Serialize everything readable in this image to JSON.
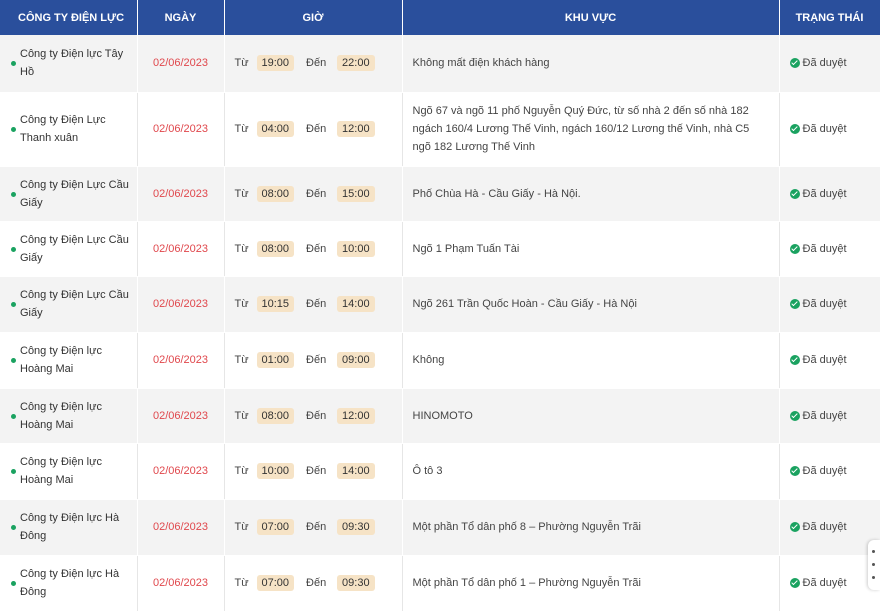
{
  "headers": {
    "company": "CÔNG TY ĐIỆN LỰC",
    "date": "NGÀY",
    "time": "GIỜ",
    "area": "KHU VỰC",
    "status": "TRẠNG THÁI"
  },
  "labels": {
    "from": "Từ",
    "to": "Đến"
  },
  "colors": {
    "header_bg": "#2a4f9c",
    "date": "#e0474c",
    "time_pill": "#f6e3c6",
    "status_green": "#1aa260"
  },
  "rows": [
    {
      "company": "Công ty Điện lực Tây Hồ",
      "date": "02/06/2023",
      "from": "19:00",
      "to": "22:00",
      "area": "Không mất điện khách hàng",
      "status": "Đã duyệt"
    },
    {
      "company": "Công ty Điện Lực Thanh xuân",
      "date": "02/06/2023",
      "from": "04:00",
      "to": "12:00",
      "area": "Ngõ 67 và ngõ 11 phố Nguyễn Quý Đức, từ số nhà 2 đến số nhà 182 ngách 160/4 Lương Thế Vinh, ngách 160/12 Lương thế Vinh, nhà C5 ngõ 182 Lương Thế Vinh",
      "status": "Đã duyệt"
    },
    {
      "company": "Công ty Điện Lực Cầu Giấy",
      "date": "02/06/2023",
      "from": "08:00",
      "to": "15:00",
      "area": "Phố Chùa Hà - Cầu Giấy - Hà Nội.",
      "status": "Đã duyệt"
    },
    {
      "company": "Công ty Điện Lực Cầu Giấy",
      "date": "02/06/2023",
      "from": "08:00",
      "to": "10:00",
      "area": "Ngõ 1 Phạm Tuấn Tài",
      "status": "Đã duyệt"
    },
    {
      "company": "Công ty Điện Lực Cầu Giấy",
      "date": "02/06/2023",
      "from": "10:15",
      "to": "14:00",
      "area": "Ngõ 261 Trần Quốc Hoàn - Cầu Giấy - Hà Nội",
      "status": "Đã duyệt"
    },
    {
      "company": "Công ty Điện lực Hoàng Mai",
      "date": "02/06/2023",
      "from": "01:00",
      "to": "09:00",
      "area": "Không",
      "status": "Đã duyệt"
    },
    {
      "company": "Công ty Điện lực Hoàng Mai",
      "date": "02/06/2023",
      "from": "08:00",
      "to": "12:00",
      "area": "HINOMOTO",
      "status": "Đã duyệt"
    },
    {
      "company": "Công ty Điện lực Hoàng Mai",
      "date": "02/06/2023",
      "from": "10:00",
      "to": "14:00",
      "area": "Ô tô 3",
      "status": "Đã duyệt"
    },
    {
      "company": "Công ty Điện lực Hà Đông",
      "date": "02/06/2023",
      "from": "07:00",
      "to": "09:30",
      "area": "Một phần Tổ dân phố 8 – Phường Nguyễn Trãi",
      "status": "Đã duyệt"
    },
    {
      "company": "Công ty Điện lực Hà Đông",
      "date": "02/06/2023",
      "from": "07:00",
      "to": "09:30",
      "area": "Một phần Tổ dân phố 1 – Phường Nguyễn Trãi",
      "status": "Đã duyệt"
    }
  ]
}
